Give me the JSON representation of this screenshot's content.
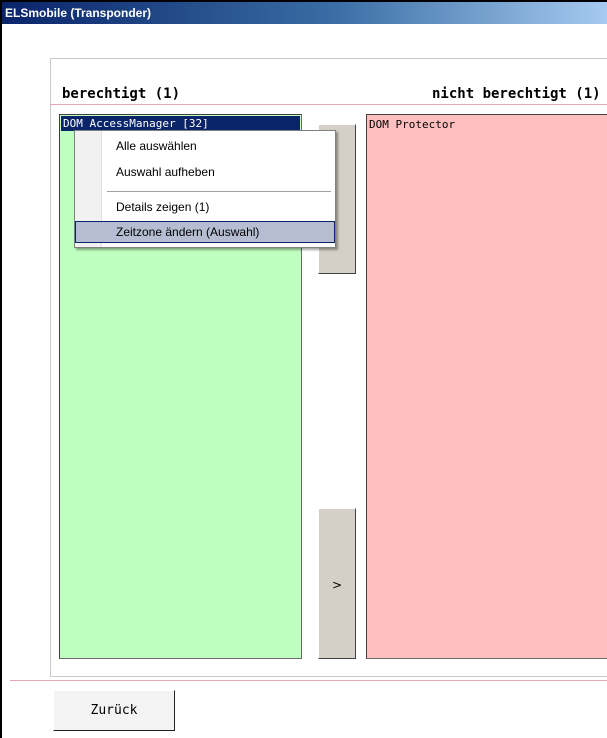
{
  "window": {
    "title": "ELSmobile (Transponder)"
  },
  "sections": {
    "left_title": "berechtigt (1)",
    "right_title": "nicht berechtigt (1)"
  },
  "left_list": {
    "items": [
      "DOM AccessManager [32]"
    ]
  },
  "right_list": {
    "items": [
      "DOM Protector"
    ]
  },
  "move_buttons": {
    "up_label": "",
    "down_label": ">"
  },
  "context_menu": {
    "items": [
      "Alle auswählen",
      "Auswahl aufheben",
      "Details zeigen (1)",
      "Zeitzone ändern (Auswahl)"
    ],
    "highlighted_index": 3
  },
  "footer": {
    "back_label": "Zurück"
  },
  "colors": {
    "allowed_bg": "#bfffbf",
    "denied_bg": "#ffbfbf",
    "title_bar": "#0a246a",
    "menu_highlight": "#b6bdd2"
  }
}
